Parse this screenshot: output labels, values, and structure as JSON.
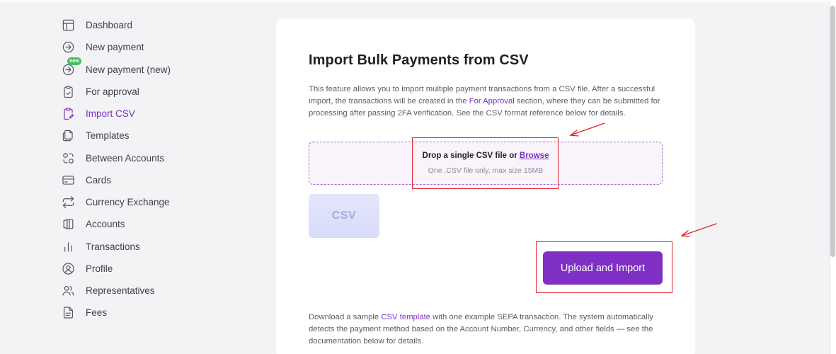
{
  "sidebar": {
    "items": [
      {
        "label": "Dashboard",
        "icon": "dashboard-icon"
      },
      {
        "label": "New payment",
        "icon": "arrow-circle-icon"
      },
      {
        "label": "New payment (new)",
        "icon": "arrow-circle-icon",
        "badge": "new"
      },
      {
        "label": "For approval",
        "icon": "clipboard-icon"
      },
      {
        "label": "Import CSV",
        "icon": "clipboard-edit-icon",
        "active": true
      },
      {
        "label": "Templates",
        "icon": "copy-icon"
      },
      {
        "label": "Between Accounts",
        "icon": "between-accounts-icon"
      },
      {
        "label": "Cards",
        "icon": "card-icon"
      },
      {
        "label": "Currency Exchange",
        "icon": "exchange-icon"
      },
      {
        "label": "Accounts",
        "icon": "accounts-icon"
      },
      {
        "label": "Transactions",
        "icon": "bar-chart-icon"
      },
      {
        "label": "Profile",
        "icon": "user-circle-icon"
      },
      {
        "label": "Representatives",
        "icon": "users-icon"
      },
      {
        "label": "Fees",
        "icon": "document-icon"
      }
    ]
  },
  "main": {
    "title": "Import Bulk Payments from CSV",
    "intro": {
      "part1": "This feature allows you to import multiple payment transactions from a CSV file. After a successful import, the transactions will be created in the ",
      "link": "For Approval",
      "part2": " section, where they can be submitted for processing after passing 2FA verification. See the CSV format reference below for details."
    },
    "dropzone": {
      "text": "Drop a single CSV file or ",
      "browse": "Browse",
      "hint": "One .CSV file only, max size 15MB"
    },
    "csv_thumb_label": "CSV",
    "upload_button": "Upload and Import",
    "footer": {
      "part1": "Download a sample ",
      "link": "CSV template",
      "part2": " with one example SEPA transaction. The system automatically detects the payment method based on the Account Number, Currency, and other fields — see the documentation below for details."
    }
  },
  "colors": {
    "accent": "#7f2fc4",
    "annotation": "#e0202a",
    "badge": "#47c15c"
  }
}
